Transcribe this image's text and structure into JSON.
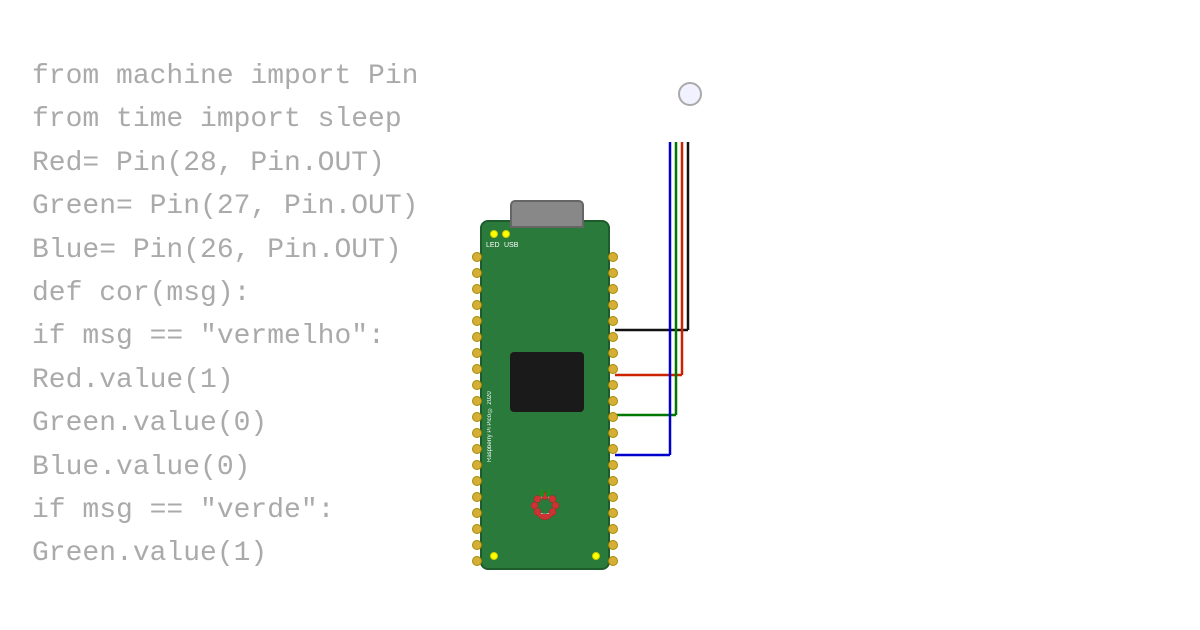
{
  "code": {
    "lines": [
      {
        "text": "from machine import Pin",
        "indent": 0
      },
      {
        "text": "from time import sleep",
        "indent": 0
      },
      {
        "text": "Red= Pin(28, Pin.OUT)",
        "indent": 0
      },
      {
        "text": "Green= Pin(27, Pin.OUT)",
        "indent": 0
      },
      {
        "text": "Blue= Pin(26, Pin.OUT)",
        "indent": 0
      },
      {
        "text": "def cor(msg):",
        "indent": 0
      },
      {
        "text": "if msg == \"vermelho\":",
        "indent": 1
      },
      {
        "text": "Red.value(1)",
        "indent": 2
      },
      {
        "text": "Green.value(0)",
        "indent": 2
      },
      {
        "text": "Blue.value(0)",
        "indent": 2
      },
      {
        "text": "if msg == \"verde\":",
        "indent": 1
      },
      {
        "text": "Green.value(1)",
        "indent": 2
      }
    ]
  },
  "diagram": {
    "board_name": "Raspberry Pi Pico © 2020",
    "led_label": "LED",
    "usb_label": "USB",
    "wire_colors": {
      "black": "#111111",
      "red": "#cc2200",
      "green": "#007700",
      "blue": "#0000cc"
    }
  }
}
